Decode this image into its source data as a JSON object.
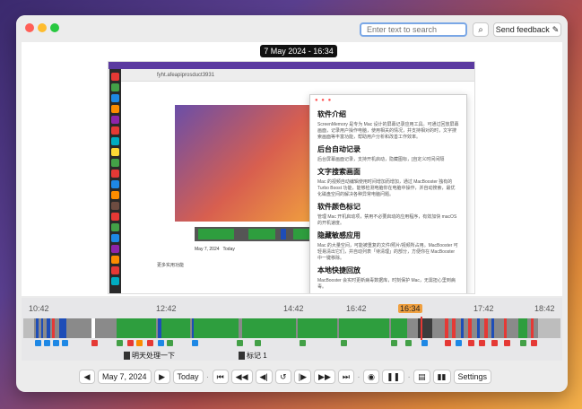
{
  "toolbar": {
    "search_placeholder": "Enter text to search",
    "feedback_label": "Send feedback"
  },
  "frame": {
    "datetime": "7 May 2024 - 16:34"
  },
  "screenshot": {
    "url": "fyht.afeapiprosduct3931",
    "page_text": "更多实用功能",
    "inner_date": "May 7, 2024",
    "inner_today": "Today",
    "overlay": {
      "title": "软件介绍",
      "intro": "ScreenMemory 是专为 Mac 设计的屏幕记录应用工具。可通过回放屏幕画面，记录用户操作电脑，使用相关的情况，并支持相对的时，文字搜索画面等丰富功能，帮助用户分析和改善工作效率。",
      "sections": [
        {
          "h": "后台自动记录",
          "p": "后台屏幕画面记录，支持开机启动，隐藏图标，[自定义时间间隔"
        },
        {
          "h": "文字搜索画面",
          "p": "Mac 的视频自动编辑使用时间增加而增加，通过 MacBooster 独有的 Turbo Boost 功能，能够检测电脑你在电脑中操作，并自动搜索，最优化磁盘空间的解决各种异常电脑问题。"
        },
        {
          "h": "软件颜色标记",
          "p": "管理 Mac 开机启动项，禁用不必要启动的应用程序，有效加快 macOS 的开机速度。"
        },
        {
          "h": "隐藏敏感应用",
          "p": "Mac 的大量空间，可能被重复的文件/照片/视频所占用。MacBooster 可轻易清出它们，并自动列表「待清理」的部分，方便你在 MacBooster 中一键移除。"
        },
        {
          "h": "本地快捷回放",
          "p": "MacBooster 会实时更新病毒数据库，时刻保护 Mac，无需担心里到病毒。"
        }
      ]
    }
  },
  "timeline": {
    "ticks": [
      "10:42",
      "12:42",
      "14:42",
      "16:42",
      "17:42",
      "18:42"
    ],
    "current": "16:34",
    "bookmarks": [
      {
        "label": "明天处理一下"
      },
      {
        "label": "标记 1"
      }
    ]
  },
  "controls": {
    "date": "May 7, 2024",
    "today": "Today",
    "settings": "Settings"
  }
}
